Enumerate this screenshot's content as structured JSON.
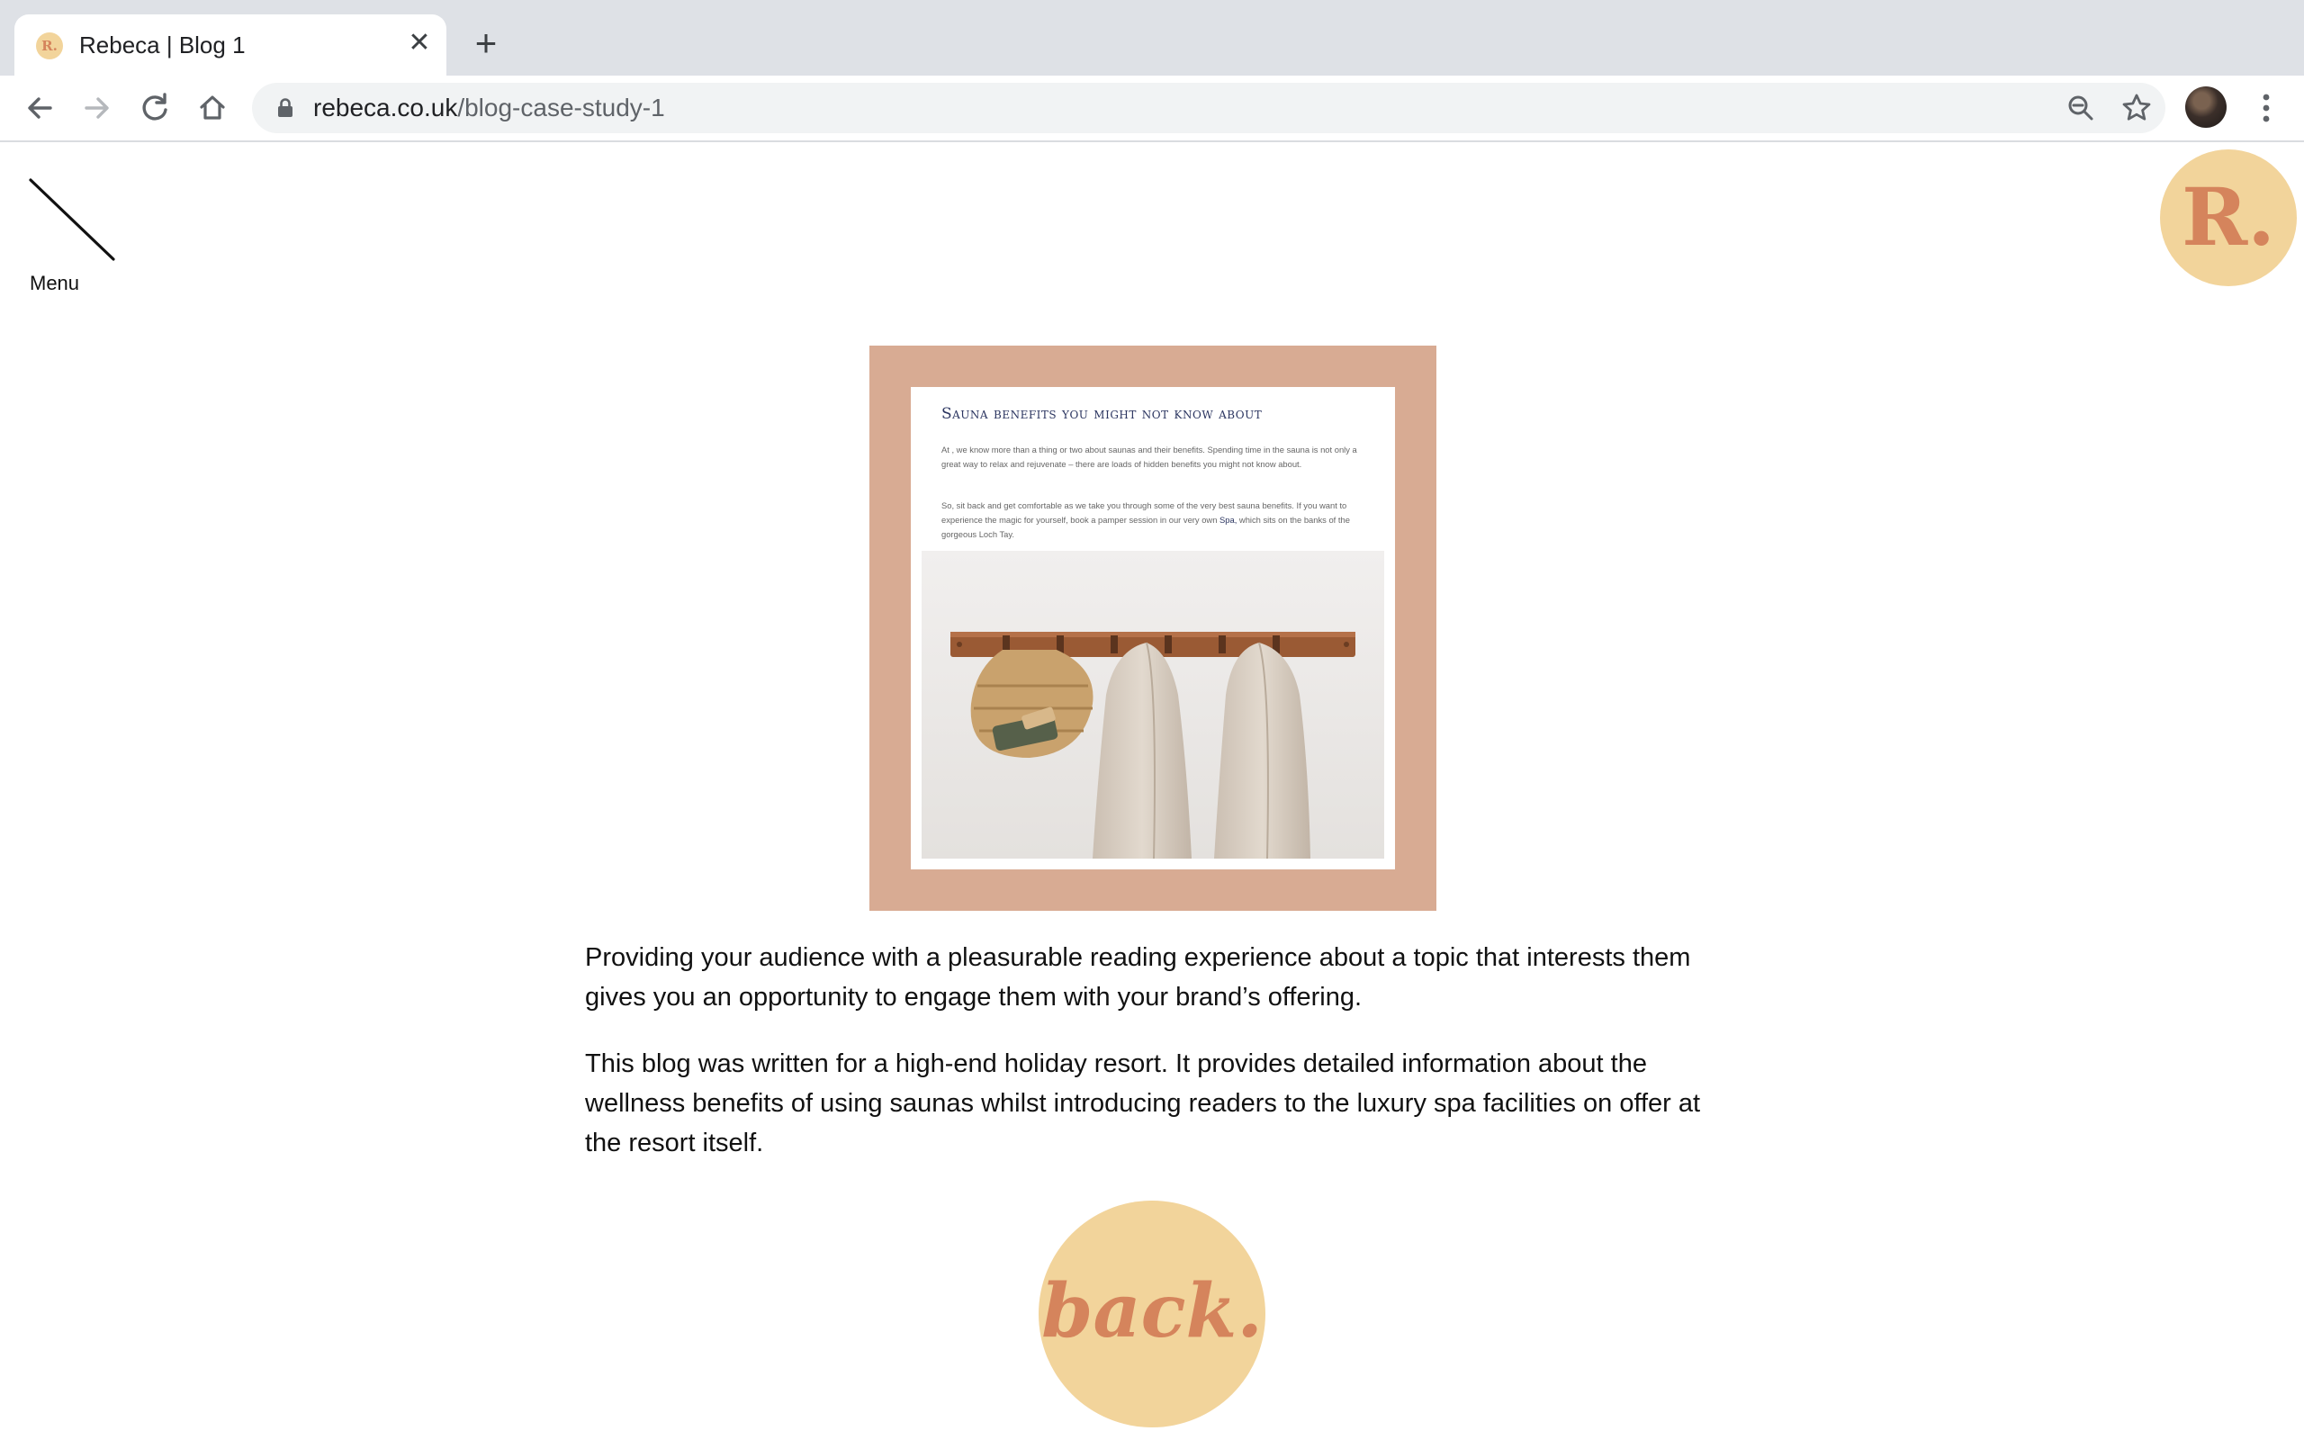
{
  "browser": {
    "tab_favicon_text": "R.",
    "tab_title": "Rebeca | Blog 1",
    "tab_close": "✕",
    "new_tab": "+",
    "url_domain": "rebeca.co.uk",
    "url_path": "/blog-case-study-1"
  },
  "header": {
    "menu_label": "Menu",
    "logo_text": "R."
  },
  "feature_card": {
    "title": "Sauna benefits you might not know about",
    "para1": "At                              , we know more than a thing or two about saunas and their benefits. Spending time in the sauna is not only a great way to relax and rejuvenate – there are loads of hidden benefits you might not know about.",
    "para2_text": "So, sit back and get comfortable as we take you through some of the very best sauna benefits. If you want to experience the magic for yourself, book a pamper session in our very own",
    "para2_link": "Spa,",
    "para2_end": "which sits on the banks of the gorgeous Loch Tay."
  },
  "article": {
    "para1": "Providing your audience with a pleasurable reading experience about a topic that interests them gives you an opportunity to engage them with your brand’s offering.",
    "para2": "This blog was written for a high-end holiday resort. It provides detailed information about the wellness benefits of using saunas whilst introducing readers to the luxury spa facilities on offer at the resort itself.",
    "back_label": "back."
  },
  "colors": {
    "brand_cream": "#f2d49b",
    "brand_terracotta": "#d5845c",
    "feature_bg": "#d8ab93",
    "card_title": "#2b3560"
  },
  "icons": [
    "back-arrow-icon",
    "forward-arrow-icon",
    "reload-icon",
    "home-icon",
    "lock-icon",
    "zoom-icon",
    "star-icon",
    "kebab-menu-icon",
    "menu-slash-icon"
  ]
}
